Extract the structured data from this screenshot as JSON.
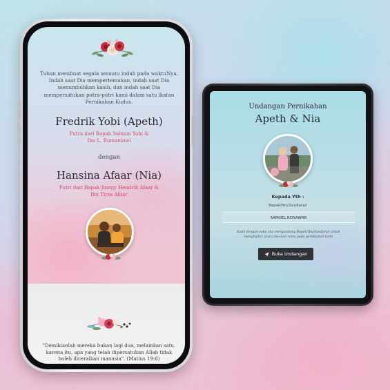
{
  "phone": {
    "intro": "Tuhan membuat segala sesuatu indah pada waktuNya. Indah saat Dia mempertemukan, indah saat Dia menumbuhkan kasih, dan indah saat Dia mempersatukan putra-putri kami dalam satu ikatan Pernikahan Kudus.",
    "groom_name": "Fredrik Yobi (Apeth)",
    "groom_parents_line1": "Putra dari Bapak Salmon Yobi &",
    "groom_parents_line2": "Ibu L. Rumaniowi",
    "connector": "dengan",
    "bride_name": "Hansina Afaar (Nia)",
    "bride_parents_line1": "Putri dari Bapak Jimmy Hendrik Afaar &",
    "bride_parents_line2": "Ibu Tirsa Afaar",
    "quote": "\"Demikianlah mereka bukan lagi dua, melainkan satu. karena itu, apa yang telah dipersatukan Allah tidak boleh diceraikan manusia\". (Matius 19:6)"
  },
  "tablet": {
    "subtitle": "Undangan Pernikahan",
    "title": "Apeth & Nia",
    "kepada": "Kepada Yth :",
    "salutation": "Bapak/Ibu/Saudara/i",
    "guest_name": "SAMUEL ROSAWRR",
    "note": "Kami dengan suka cita mengundang Bapak/Ibu/Saudara/i untuk menghadiri acara doa dan restu pada pernikahan kami",
    "button_label": "Buka Undangan",
    "button_icon": "send-icon"
  },
  "colors": {
    "accent_red": "#d04a5c",
    "button_bg": "#2f3237",
    "text_dark": "#2b2b33"
  }
}
